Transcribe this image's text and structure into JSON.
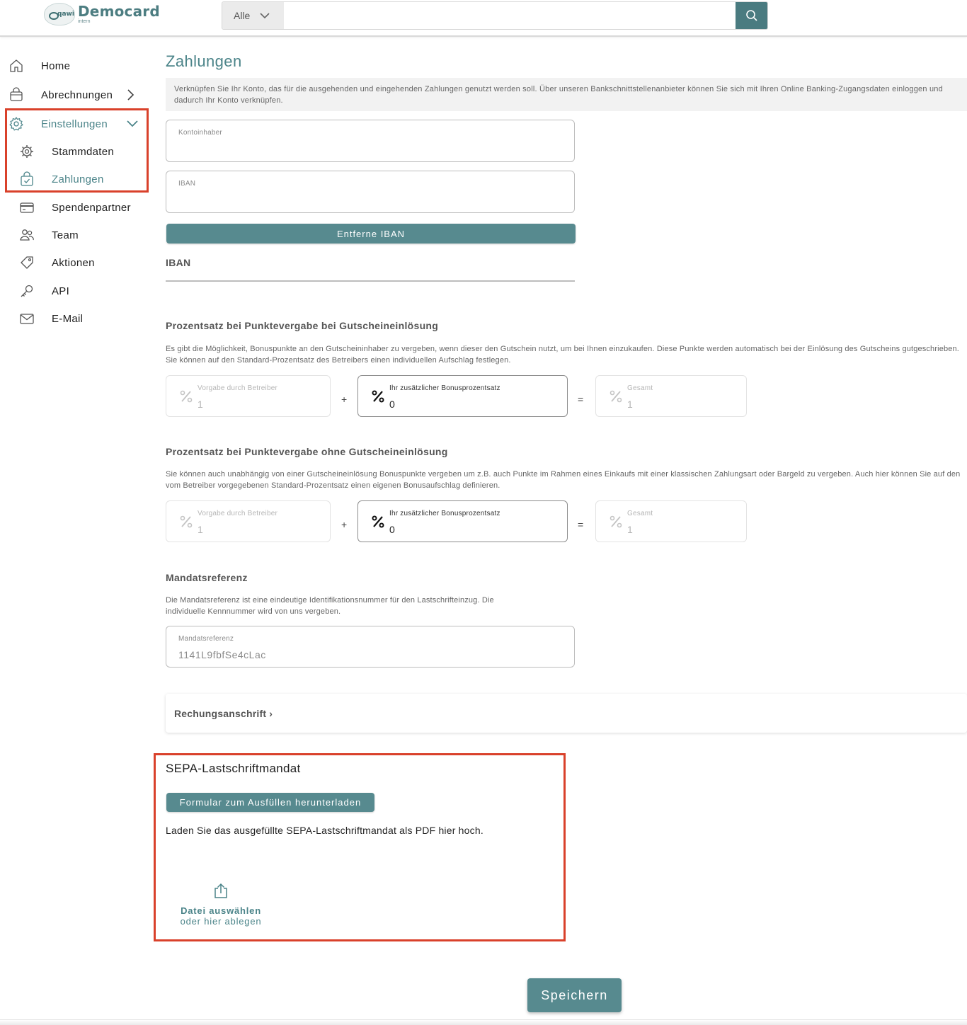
{
  "header": {
    "logo_title": "Democard",
    "logo_sub": "intern",
    "logo_mark": "qawi",
    "search": {
      "category": "Alle",
      "placeholder": ""
    }
  },
  "sidebar": {
    "items": [
      {
        "label": "Home",
        "icon": "home-icon"
      },
      {
        "label": "Abrechnungen",
        "icon": "bag-icon"
      },
      {
        "label": "Einstellungen",
        "icon": "gear-icon"
      },
      {
        "label": "Stammdaten",
        "icon": "cog-icon"
      },
      {
        "label": "Zahlungen",
        "icon": "bag-check-icon"
      },
      {
        "label": "Spendenpartner",
        "icon": "card-icon"
      },
      {
        "label": "Team",
        "icon": "team-icon"
      },
      {
        "label": "Aktionen",
        "icon": "tag-icon"
      },
      {
        "label": "API",
        "icon": "key-icon"
      },
      {
        "label": "E-Mail",
        "icon": "mail-icon"
      }
    ]
  },
  "main": {
    "title": "Zahlungen",
    "info": "Verknüpfen Sie Ihr Konto, das für die ausgehenden und eingehenden Zahlungen genutzt werden soll. Über unseren Bankschnittstellenanbieter können Sie sich mit Ihren Online Banking-Zugangsdaten einloggen und dadurch Ihr Konto verknüpfen.",
    "kontoinhaber": {
      "label": "Kontoinhaber",
      "value": ""
    },
    "iban_field": {
      "label": "IBAN",
      "value": ""
    },
    "remove_iban_button": "Entferne IBAN",
    "iban_heading": "IBAN",
    "section1": {
      "title": "Prozentsatz bei Punktevergabe bei Gutscheineinlösung",
      "desc": "Es gibt die Möglichkeit, Bonuspunkte an den Gutscheininhaber zu vergeben, wenn dieser den Gutschein nutzt, um bei Ihnen einzukaufen. Diese Punkte werden automatisch bei der Einlösung des Gutscheins gutgeschrieben. Sie können auf den Standard-Prozentsatz des Betreibers einen individuellen Aufschlag festlegen.",
      "operator": {
        "label": "Vorgabe durch Betreiber",
        "value": "1"
      },
      "plus": "+",
      "bonus": {
        "label": "Ihr zusätzlicher Bonusprozentsatz",
        "value": "0"
      },
      "equals": "=",
      "total": {
        "label": "Gesamt",
        "value": "1"
      }
    },
    "section2": {
      "title": "Prozentsatz bei Punktevergabe ohne Gutscheineinlösung",
      "desc": "Sie können auch unabhängig von einer Gutscheineinlösung Bonuspunkte vergeben um z.B. auch Punkte im Rahmen eines Einkaufs mit einer klassischen Zahlungsart oder Bargeld zu vergeben. Auch hier können Sie auf den vom Betreiber vorgegebenen Standard-Prozentsatz einen eigenen Bonusaufschlag definieren.",
      "operator": {
        "label": "Vorgabe durch Betreiber",
        "value": "1"
      },
      "plus": "+",
      "bonus": {
        "label": "Ihr zusätzlicher Bonusprozentsatz",
        "value": "0"
      },
      "equals": "=",
      "total": {
        "label": "Gesamt",
        "value": "1"
      }
    },
    "mandate": {
      "title": "Mandatsreferenz",
      "desc_line1": "Die Mandatsreferenz ist eine eindeutige Identifikationsnummer für den Lastschrifteinzug. Die",
      "desc_line2": "individuelle Kennnummer wird von uns vergeben.",
      "label": "Mandatsreferenz",
      "value": "1141L9fbfSe4cLac"
    },
    "billing_address": "Rechungsanschrift ›",
    "sepa": {
      "title": "SEPA-Lastschriftmandat",
      "download_button": "Formular zum Ausfüllen herunterladen",
      "text": "Laden Sie das ausgefüllte SEPA-Lastschriftmandat als PDF hier hoch.",
      "upload_line1": "Datei auswählen",
      "upload_line2": "oder hier ablegen"
    },
    "save_button": "Speichern"
  },
  "colors": {
    "accent": "#4b8489",
    "button": "#578a8f",
    "highlight_box": "#d9412b"
  }
}
